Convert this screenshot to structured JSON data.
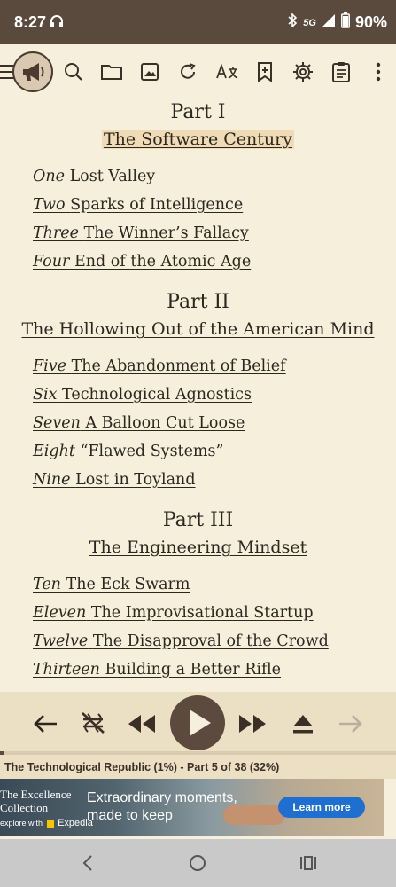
{
  "status_bar": {
    "time": "8:27",
    "network": "5G",
    "battery": "90%"
  },
  "toolbar": {
    "icons": [
      "menu-icon",
      "megaphone-logo-icon",
      "search-icon",
      "folder-icon",
      "image-icon",
      "refresh-icon",
      "translate-icon",
      "bookmark-add-icon",
      "settings-icon",
      "clipboard-icon",
      "more-vert-icon"
    ]
  },
  "content": {
    "parts": [
      {
        "title": "Part I",
        "subtitle": "The Software Century",
        "chapters": [
          {
            "num": "One",
            "name": "Lost Valley"
          },
          {
            "num": "Two",
            "name": "Sparks of Intelligence"
          },
          {
            "num": "Three",
            "name": "The Winner’s Fallacy"
          },
          {
            "num": "Four",
            "name": "End of the Atomic Age"
          }
        ]
      },
      {
        "title": "Part II",
        "subtitle": "The Hollowing Out of the American Mind",
        "chapters": [
          {
            "num": "Five",
            "name": "The Abandonment of Belief"
          },
          {
            "num": "Six",
            "name": "Technological Agnostics"
          },
          {
            "num": "Seven",
            "name": "A Balloon Cut Loose"
          },
          {
            "num": "Eight",
            "name": "“Flawed Systems”"
          },
          {
            "num": "Nine",
            "name": "Lost in Toyland"
          }
        ]
      },
      {
        "title": "Part III",
        "subtitle": "The Engineering Mindset",
        "chapters": [
          {
            "num": "Ten",
            "name": "The Eck Swarm"
          },
          {
            "num": "Eleven",
            "name": "The Improvisational Startup"
          },
          {
            "num": "Twelve",
            "name": "The Disapproval of the Crowd"
          },
          {
            "num": "Thirteen",
            "name": "Building a Better Rifle"
          }
        ]
      }
    ]
  },
  "player": {
    "progress_fraction": 0.01,
    "book_info": "The Technological Republic (1%) - Part 5 of 38 (32%)"
  },
  "ad": {
    "brand_line1": "The Excellence",
    "brand_line2": "Collection",
    "brand_sub": "explore with",
    "brand_partner": "Expedia",
    "headline_line1": "Extraordinary moments,",
    "headline_line2": "made to keep",
    "cta": "Learn more"
  },
  "colors": {
    "background": "#f6efdc",
    "status_bar": "#5a4a3d",
    "accent": "#5b4a3d",
    "highlight": "#efdcb6",
    "cta": "#1f6fd1"
  }
}
